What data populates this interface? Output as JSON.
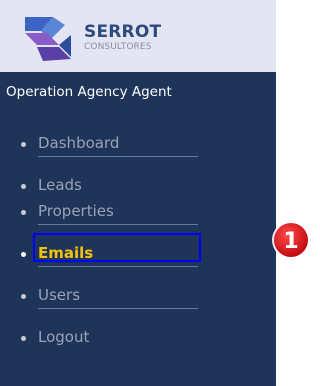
{
  "logo": {
    "name": "SERROT",
    "subtitle": "CONSULTORES"
  },
  "role_title": "Operation Agency Agent",
  "nav": {
    "items": [
      {
        "label": "Dashboard"
      },
      {
        "label": "Leads"
      },
      {
        "label": "Properties"
      },
      {
        "label": "Emails",
        "active": true
      },
      {
        "label": "Users"
      },
      {
        "label": "Logout"
      }
    ]
  },
  "annotation": {
    "marker_number": "1"
  },
  "colors": {
    "sidebar_bg": "#1f3459",
    "logo_bg": "#e4e5f2",
    "active_text": "#f4c20d",
    "highlight_border": "#0000ff",
    "marker_red": "#e8141c"
  }
}
